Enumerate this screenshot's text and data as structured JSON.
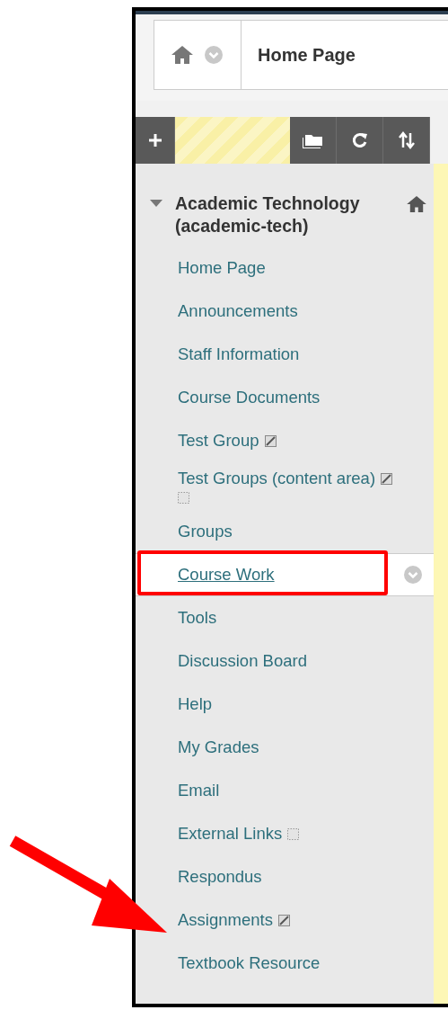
{
  "breadcrumb": {
    "title": "Home Page"
  },
  "course": {
    "title": "Academic Technology (academic-tech)",
    "expanded": true
  },
  "menu_items": [
    {
      "label": "Home Page",
      "selected": false,
      "hidden": false,
      "empty": false
    },
    {
      "label": "Announcements",
      "selected": false,
      "hidden": false,
      "empty": false
    },
    {
      "label": "Staff Information",
      "selected": false,
      "hidden": false,
      "empty": false
    },
    {
      "label": "Course Documents",
      "selected": false,
      "hidden": false,
      "empty": false
    },
    {
      "label": "Test Group",
      "selected": false,
      "hidden": true,
      "empty": false
    },
    {
      "label": "Test Groups (content area)",
      "selected": false,
      "hidden": true,
      "empty": true
    },
    {
      "label": "Groups",
      "selected": false,
      "hidden": false,
      "empty": false
    },
    {
      "label": "Course Work",
      "selected": true,
      "hidden": false,
      "empty": false,
      "highlighted": true
    },
    {
      "label": "Tools",
      "selected": false,
      "hidden": false,
      "empty": false
    },
    {
      "label": "Discussion Board",
      "selected": false,
      "hidden": false,
      "empty": false
    },
    {
      "label": "Help",
      "selected": false,
      "hidden": false,
      "empty": false
    },
    {
      "label": "My Grades",
      "selected": false,
      "hidden": false,
      "empty": false
    },
    {
      "label": "Email",
      "selected": false,
      "hidden": false,
      "empty": false
    },
    {
      "label": "External Links",
      "selected": false,
      "hidden": false,
      "empty": true
    },
    {
      "label": "Respondus",
      "selected": false,
      "hidden": false,
      "empty": false
    },
    {
      "label": "Assignments",
      "selected": false,
      "hidden": true,
      "empty": false,
      "pointed_at": true
    },
    {
      "label": "Textbook Resource",
      "selected": false,
      "hidden": false,
      "empty": false
    }
  ]
}
